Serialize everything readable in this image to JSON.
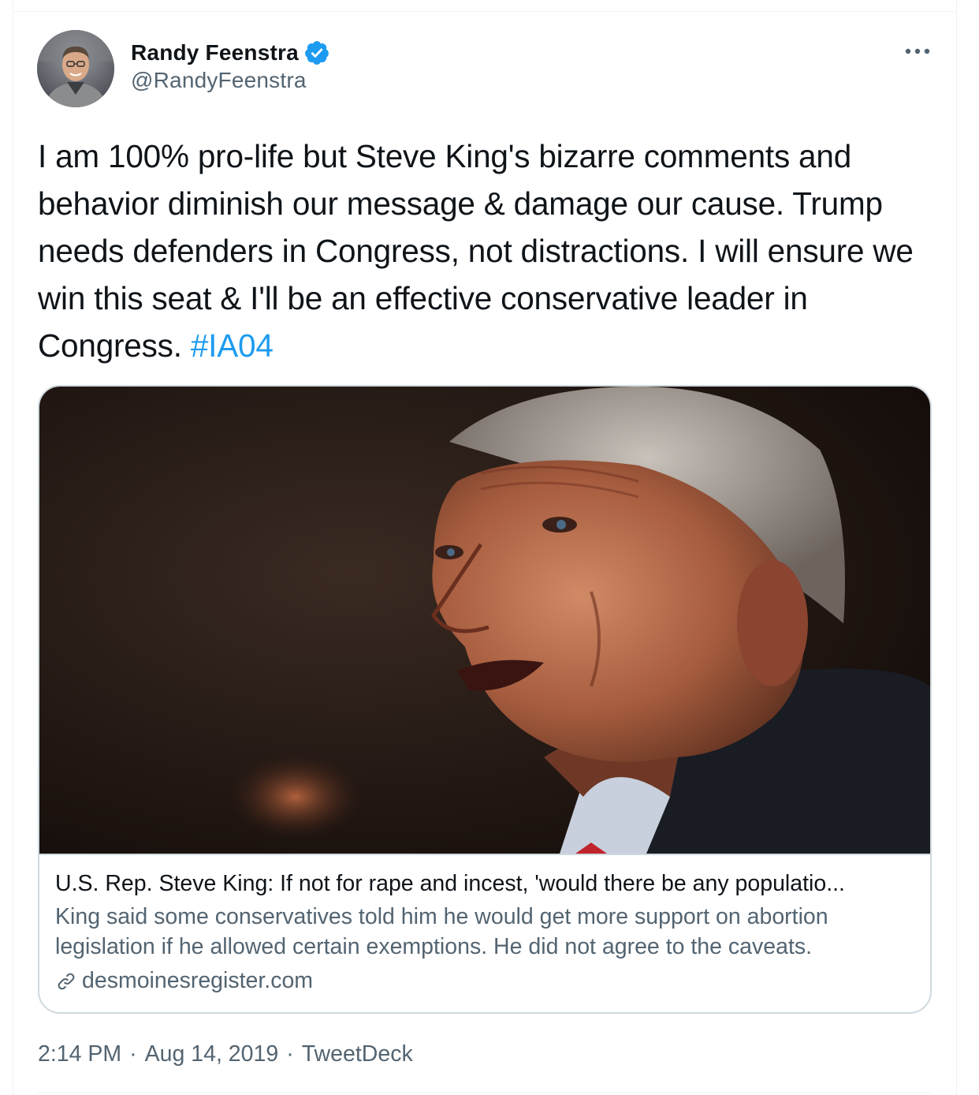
{
  "author": {
    "display_name": "Randy Feenstra",
    "handle": "@RandyFeenstra",
    "verified": true
  },
  "tweet": {
    "text": "I am 100% pro-life but Steve King's bizarre comments and behavior diminish our message & damage our cause. Trump needs defenders in Congress, not distractions. I will ensure we win this seat & I'll be an effective conservative leader in Congress.",
    "hashtag": "#IA04"
  },
  "card": {
    "title": "U.S. Rep. Steve King: If not for rape and incest, 'would there be any populatio...",
    "description": "King said some conservatives told him he would get more support on abortion legislation if he allowed certain exemptions. He did not agree to the caveats.",
    "domain": "desmoinesregister.com"
  },
  "meta": {
    "time": "2:14 PM",
    "date": "Aug 14, 2019",
    "source": "TweetDeck",
    "separator": "·"
  },
  "icons": {
    "verified": "verified-badge-icon",
    "more": "more-options-icon",
    "link": "link-icon"
  },
  "colors": {
    "accent": "#1d9bf0",
    "text_primary": "#0f1419",
    "text_secondary": "#536471",
    "border": "#cfd9de"
  }
}
